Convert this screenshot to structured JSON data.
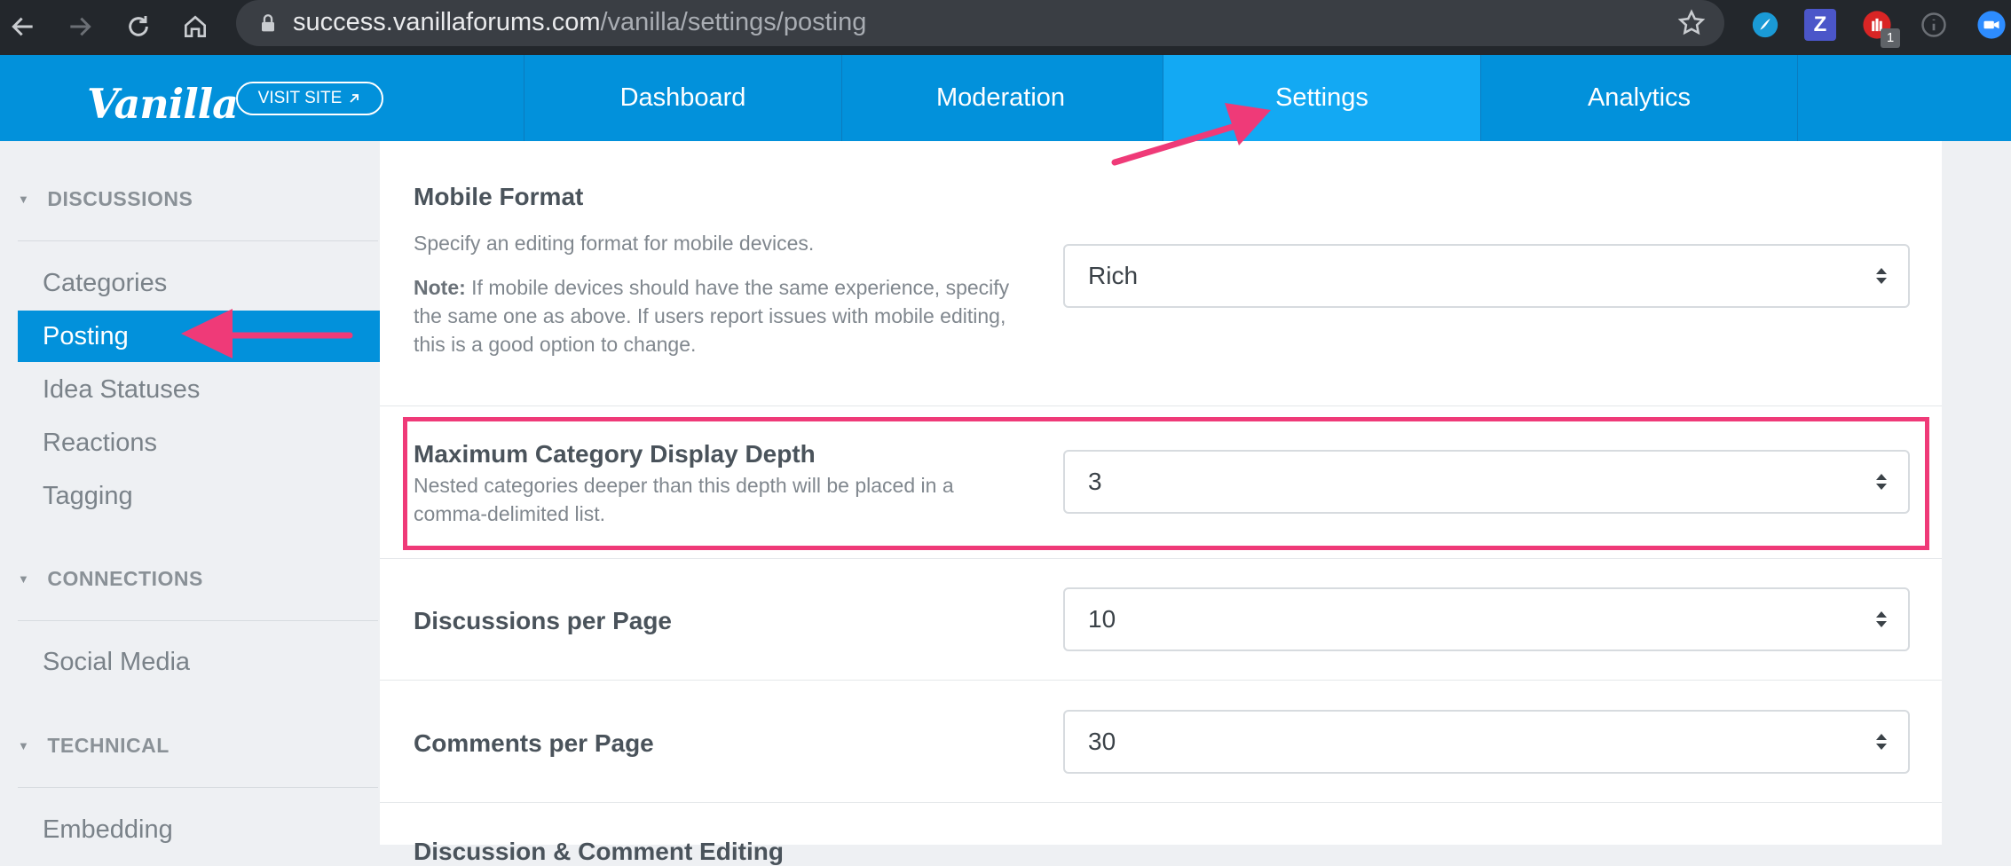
{
  "browser": {
    "url_host": "success.vanillaforums.com",
    "url_path": "/vanilla/settings/posting",
    "extension_badge": "1",
    "extension_z": "Z"
  },
  "appnav": {
    "logo": "Vanilla",
    "visit_site": "VISIT SITE",
    "tabs": [
      {
        "label": "Dashboard"
      },
      {
        "label": "Moderation"
      },
      {
        "label": "Settings"
      },
      {
        "label": "Analytics"
      }
    ]
  },
  "sidebar": {
    "sections": [
      {
        "heading": "DISCUSSIONS",
        "items": [
          "Categories",
          "Posting",
          "Idea Statuses",
          "Reactions",
          "Tagging"
        ]
      },
      {
        "heading": "CONNECTIONS",
        "items": [
          "Social Media"
        ]
      },
      {
        "heading": "TECHNICAL",
        "items": [
          "Embedding"
        ]
      }
    ],
    "active_item": "Posting"
  },
  "settings": {
    "mobile_format": {
      "label": "Mobile Format",
      "description": "Specify an editing format for mobile devices.",
      "note_label": "Note:",
      "note_text": "If mobile devices should have the same experience, specify the same one as above. If users report issues with mobile editing, this is a good option to change.",
      "value": "Rich"
    },
    "max_depth": {
      "label": "Maximum Category Display Depth",
      "description": "Nested categories deeper than this depth will be placed in a comma-delimited list.",
      "value": "3"
    },
    "discussions_per_page": {
      "label": "Discussions per Page",
      "value": "10"
    },
    "comments_per_page": {
      "label": "Comments per Page",
      "value": "30"
    },
    "next_row_label": "Discussion & Comment Editing"
  },
  "colors": {
    "nav_blue": "#0291db",
    "active_tab": "#13a9f3",
    "annotation_pink": "#ef3a78"
  }
}
